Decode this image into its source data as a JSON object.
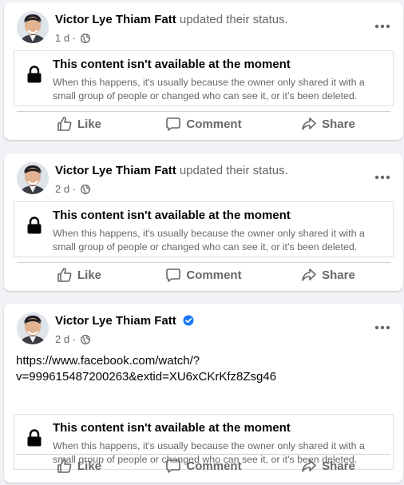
{
  "posts": [
    {
      "author": "Victor Lye Thiam Fatt",
      "status_text": "updated their status.",
      "time": "1 d",
      "unavailable_title": "This content isn't available at the moment",
      "unavailable_body": "When this happens, it's usually because the owner only shared it with a small group of people or changed who can see it, or it's been deleted.",
      "actions": {
        "like": "Like",
        "comment": "Comment",
        "share": "Share"
      }
    },
    {
      "author": "Victor Lye Thiam Fatt",
      "status_text": "updated their status.",
      "time": "2 d",
      "unavailable_title": "This content isn't available at the moment",
      "unavailable_body": "When this happens, it's usually because the owner only shared it with a small group of people or changed who can see it, or it's been deleted.",
      "actions": {
        "like": "Like",
        "comment": "Comment",
        "share": "Share"
      }
    },
    {
      "author": "Victor Lye Thiam Fatt",
      "verified": true,
      "time": "2 d",
      "text_line1": "https://www.facebook.com/watch/?",
      "text_line2": "v=999615487200263&extid=XU6xCKrKfz8Zsg46",
      "unavailable_title": "This content isn't available at the moment",
      "unavailable_body": "When this happens, it's usually because the owner only shared it with a small group of people or changed who can see it, or it's been deleted.",
      "actions": {
        "like": "Like",
        "comment": "Comment",
        "share": "Share"
      }
    }
  ],
  "colors": {
    "accent": "#1877f2",
    "secondary_text": "#65676b",
    "primary_text": "#050505",
    "background": "#f0f2f5"
  },
  "icons": {
    "audience": "globe-icon",
    "menu": "more-horizontal-icon",
    "lock": "lock-icon",
    "like": "thumbs-up-icon",
    "comment": "comment-bubble-icon",
    "share": "share-arrow-icon",
    "verified": "verified-badge-icon"
  }
}
